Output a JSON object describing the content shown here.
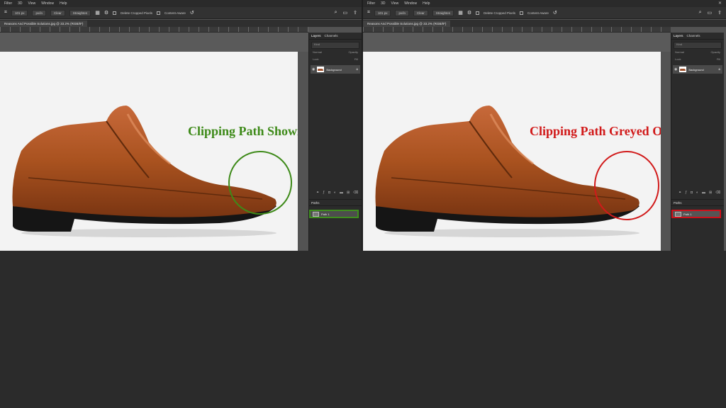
{
  "menu": {
    "items": [
      "Filter",
      "3D",
      "View",
      "Window",
      "Help"
    ],
    "close": "✕"
  },
  "options": {
    "field1": "101 px",
    "field2": "px/in",
    "clear": "Clear",
    "straighten": "Straighten",
    "delete_cropped": "Delete Cropped Pixels",
    "content_aware": "Content-Aware"
  },
  "document": {
    "left_tab": "Reasons And Possible Solutions.jpg @ 33.2% (RGB/8*)",
    "right_tab": "Reasons And Possible Solutions.jpg @ 33.2% (RGB/8*)"
  },
  "panel": {
    "tab_layers": "Layers",
    "tab_channels": "Channels",
    "kind": "Kind",
    "normal": "Normal",
    "opacity": "Opacity",
    "lock": "Lock",
    "fill": "Fill",
    "layer_name": "Background",
    "paths_title": "Paths",
    "path_name": "Path 1"
  },
  "left": {
    "caption": "Clipping Path Showing"
  },
  "right": {
    "caption": "Clipping Path Greyed Out Photoshop"
  },
  "colors": {
    "good": "#3e8a19",
    "bad": "#d11a1a",
    "shoe": "#a0522d"
  }
}
